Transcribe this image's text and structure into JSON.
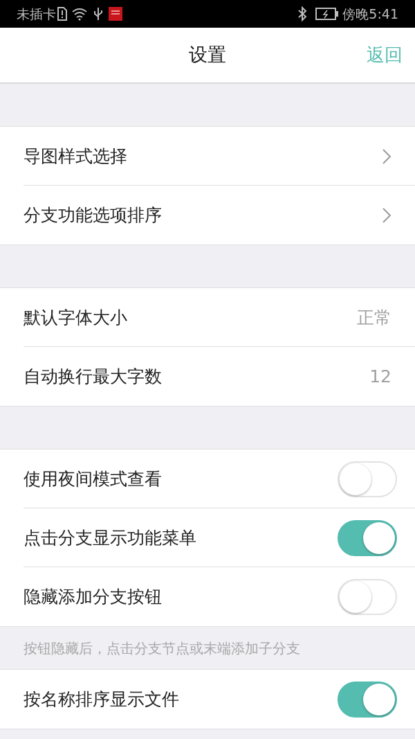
{
  "status_bar": {
    "carrier": "未插卡",
    "time": "傍晚5:41"
  },
  "nav": {
    "title": "设置",
    "back": "返回"
  },
  "groups": [
    {
      "rows": [
        {
          "kind": "link",
          "label": "导图样式选择"
        },
        {
          "kind": "link",
          "label": "分支功能选项排序"
        }
      ]
    },
    {
      "rows": [
        {
          "kind": "value",
          "label": "默认字体大小",
          "value": "正常"
        },
        {
          "kind": "value",
          "label": "自动换行最大字数",
          "value": "12"
        }
      ]
    },
    {
      "rows": [
        {
          "kind": "toggle",
          "label": "使用夜间模式查看",
          "on": false
        },
        {
          "kind": "toggle",
          "label": "点击分支显示功能菜单",
          "on": true
        },
        {
          "kind": "toggle",
          "label": "隐藏添加分支按钮",
          "on": false
        }
      ],
      "note": "按钮隐藏后，点击分支节点或末端添加子分支"
    },
    {
      "rows": [
        {
          "kind": "toggle",
          "label": "按名称排序显示文件",
          "on": true
        }
      ]
    }
  ]
}
